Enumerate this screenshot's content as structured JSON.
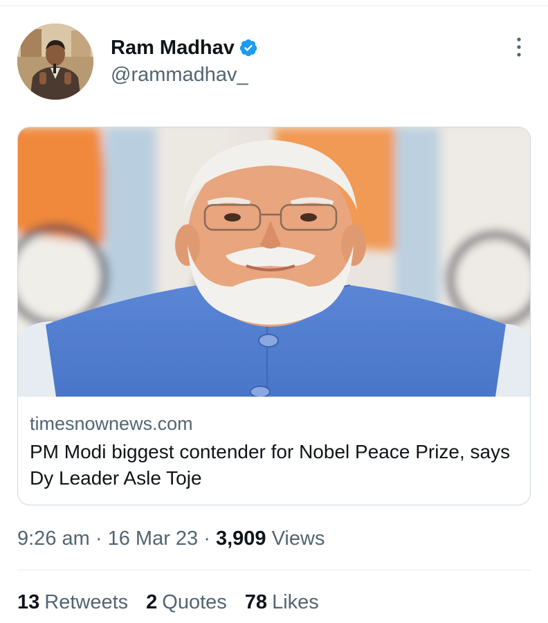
{
  "author": {
    "display_name": "Ram Madhav",
    "handle": "@rammadhav_",
    "verified": true,
    "verified_color": "#1d9bf0"
  },
  "card": {
    "domain": "timesnownews.com",
    "title": "PM Modi biggest contender for Nobel Peace Prize, says Dy Leader Asle Toje"
  },
  "meta": {
    "time": "9:26 am",
    "separator": "·",
    "date": "16 Mar 23",
    "views_count": "3,909",
    "views_label": "Views"
  },
  "stats": [
    {
      "count": "13",
      "label": "Retweets"
    },
    {
      "count": "2",
      "label": "Quotes"
    },
    {
      "count": "78",
      "label": "Likes"
    }
  ],
  "icons": {
    "more": "more-vertical-icon",
    "verified": "verified-badge-icon"
  },
  "colors": {
    "text_primary": "#0f1419",
    "text_secondary": "#536471",
    "border": "#cfd9de"
  }
}
